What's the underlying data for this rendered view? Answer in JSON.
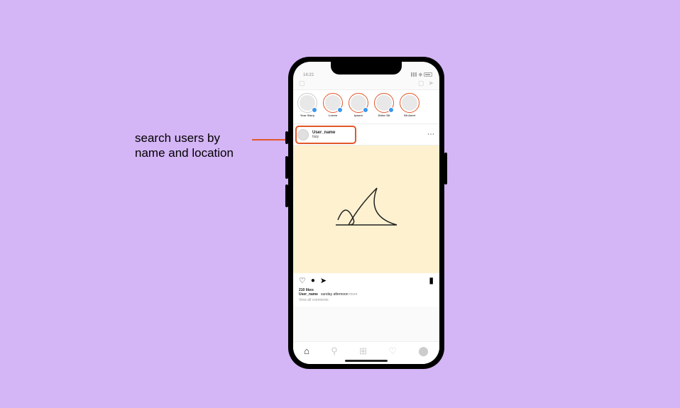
{
  "annotation": {
    "line1": "search users by",
    "line2": "name and location"
  },
  "status_time": "14:21",
  "stories": [
    {
      "label": "Your Story",
      "gray": true,
      "add": true
    },
    {
      "label": "Lorem",
      "add": true
    },
    {
      "label": "Ipsum",
      "add": true
    },
    {
      "label": "Dolor Sit",
      "add": true
    },
    {
      "label": "Sit Amet"
    }
  ],
  "post": {
    "username": "User_name",
    "location": "Italy",
    "likes": "210 likes",
    "caption_user": "User_name",
    "caption_text": "sunday afternoon",
    "more": "more",
    "view_all": "View all comments"
  },
  "colors": {
    "background": "#d4b5f5",
    "highlight": "#e35728",
    "post_bg": "#fdf1d0"
  }
}
